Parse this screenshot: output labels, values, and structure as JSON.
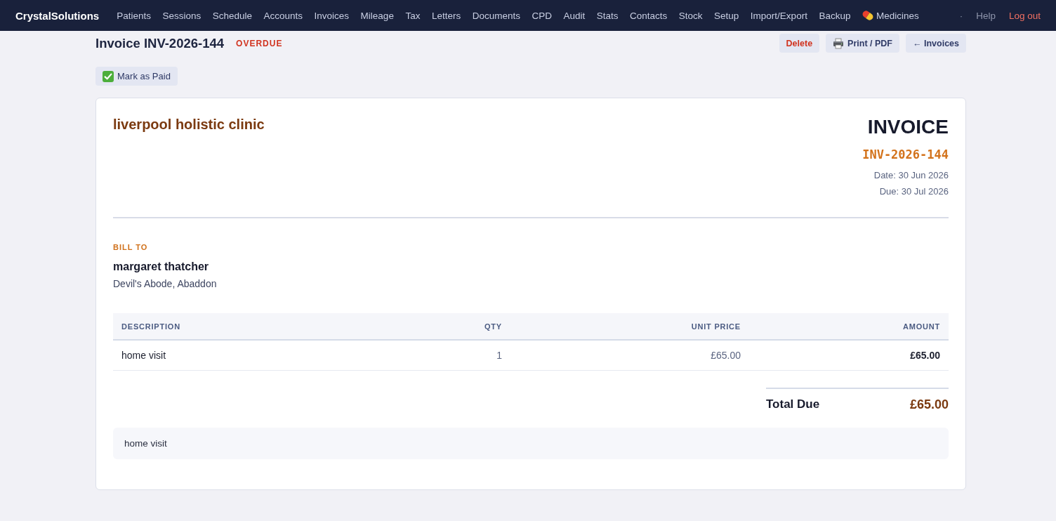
{
  "navbar": {
    "brand": "CrystalSolutions",
    "items": [
      {
        "label": "Patients",
        "kind": "text"
      },
      {
        "label": "Sessions",
        "kind": "text"
      },
      {
        "label": "Schedule",
        "kind": "text"
      },
      {
        "label": "Accounts",
        "kind": "text"
      },
      {
        "label": "Invoices",
        "kind": "text"
      },
      {
        "label": "Mileage",
        "kind": "text"
      },
      {
        "label": "Tax",
        "kind": "text"
      },
      {
        "label": "Letters",
        "kind": "text"
      },
      {
        "label": "Documents",
        "kind": "text"
      },
      {
        "label": "CPD",
        "kind": "text"
      },
      {
        "label": "Audit",
        "kind": "text"
      },
      {
        "label": "Stats",
        "kind": "text"
      },
      {
        "label": "Contacts",
        "kind": "text"
      },
      {
        "label": "Stock",
        "kind": "text"
      },
      {
        "label": "Setup",
        "kind": "text"
      },
      {
        "label": "Import/Export",
        "kind": "text"
      },
      {
        "label": "Backup",
        "kind": "text"
      },
      {
        "label": "Medicines",
        "kind": "pill"
      }
    ],
    "separator": "·",
    "links": [
      {
        "label": "Help",
        "kind": "muted"
      },
      {
        "label": "Log out",
        "kind": "danger"
      }
    ]
  },
  "header": {
    "title": "Invoice INV-2026-144",
    "status": {
      "label": "OVERDUE",
      "kind": "overdue"
    },
    "actions": [
      {
        "label": "Delete",
        "kind": "danger"
      },
      {
        "label": "Print / PDF",
        "kind": "print"
      },
      {
        "label": "← Invoices",
        "kind": "plain"
      }
    ]
  },
  "mark_paid": {
    "label": "Mark as Paid"
  },
  "invoice": {
    "clinic": "liverpool holistic clinic",
    "heading": "INVOICE",
    "number": "INV-2026-144",
    "date": "Date: 30 Jun 2026",
    "due": "Due: 30 Jul 2026",
    "bill_to": {
      "label": "BILL TO",
      "name": "margaret thatcher",
      "address": "Devil's Abode, Abaddon"
    },
    "table": {
      "columns": [
        "DESCRIPTION",
        "QTY",
        "UNIT PRICE",
        "AMOUNT"
      ],
      "rows": [
        {
          "cells": [
            "home visit",
            "1",
            "£65.00",
            "£65.00"
          ]
        }
      ]
    },
    "total": {
      "label": "Total Due",
      "value": "£65.00"
    },
    "notes": "home visit"
  }
}
